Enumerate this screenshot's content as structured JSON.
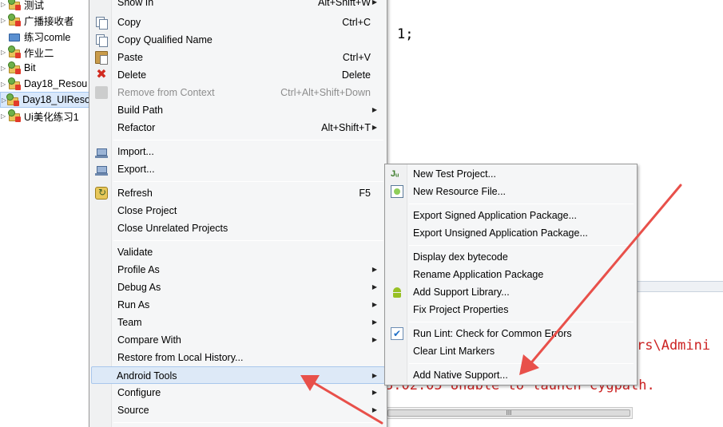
{
  "editor": {
    "code_fragment": "1;",
    "console_path_fragment": "rs\\Admini",
    "console_error_fragment": "3.02.05   Unable to launch cygpath.",
    "hscroll_grip": "III"
  },
  "tree": {
    "items": [
      {
        "label": "测试",
        "icon": "android-project-icon"
      },
      {
        "label": "广播接收者",
        "icon": "android-project-icon"
      },
      {
        "label": "练习comle",
        "icon": "java-project-icon"
      },
      {
        "label": "作业二",
        "icon": "android-project-icon"
      },
      {
        "label": "Bit",
        "icon": "android-project-icon"
      },
      {
        "label": "Day18_Resou",
        "icon": "android-project-icon"
      },
      {
        "label": "Day18_UIReso",
        "icon": "android-project-icon",
        "selected": true
      },
      {
        "label": "Ui美化练习1",
        "icon": "android-project-icon"
      }
    ]
  },
  "context_menu": {
    "show_in": {
      "label": "Show In",
      "shortcut": "Alt+Shift+W"
    },
    "copy": {
      "label": "Copy",
      "shortcut": "Ctrl+C"
    },
    "copy_qualified": {
      "label": "Copy Qualified Name"
    },
    "paste": {
      "label": "Paste",
      "shortcut": "Ctrl+V"
    },
    "delete": {
      "label": "Delete",
      "shortcut": "Delete"
    },
    "remove_context": {
      "label": "Remove from Context",
      "shortcut": "Ctrl+Alt+Shift+Down"
    },
    "build_path": {
      "label": "Build Path"
    },
    "refactor": {
      "label": "Refactor",
      "shortcut": "Alt+Shift+T"
    },
    "import": {
      "label": "Import..."
    },
    "export": {
      "label": "Export..."
    },
    "refresh": {
      "label": "Refresh",
      "shortcut": "F5"
    },
    "close_project": {
      "label": "Close Project"
    },
    "close_unrelated": {
      "label": "Close Unrelated Projects"
    },
    "validate": {
      "label": "Validate"
    },
    "profile_as": {
      "label": "Profile As"
    },
    "debug_as": {
      "label": "Debug As"
    },
    "run_as": {
      "label": "Run As"
    },
    "team": {
      "label": "Team"
    },
    "compare_with": {
      "label": "Compare With"
    },
    "restore_history": {
      "label": "Restore from Local History..."
    },
    "android_tools": {
      "label": "Android Tools"
    },
    "configure": {
      "label": "Configure"
    },
    "source": {
      "label": "Source"
    }
  },
  "android_tools_menu": {
    "new_test_project": "New Test Project...",
    "new_resource_file": "New Resource File...",
    "export_signed": "Export Signed Application Package...",
    "export_unsigned": "Export Unsigned Application Package...",
    "display_dex": "Display dex bytecode",
    "rename_package": "Rename Application Package",
    "add_support_library": "Add Support Library...",
    "fix_properties": "Fix Project Properties",
    "run_lint": "Run Lint: Check for Common Errors",
    "clear_lint": "Clear Lint Markers",
    "add_native_support": "Add Native Support..."
  },
  "colors": {
    "menu_bg": "#f5f6f7",
    "highlight": "#dde9f7",
    "annotation_arrow": "#e8504a",
    "console_error": "#cc2222"
  }
}
